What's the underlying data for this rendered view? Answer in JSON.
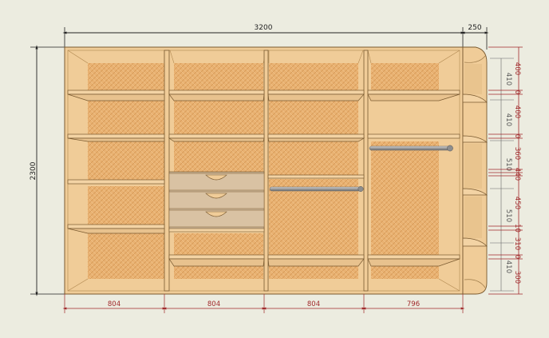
{
  "drawing": {
    "overall_width_label": "3200",
    "side_depth_label": "250",
    "overall_height_label": "2300",
    "section_widths": [
      "804",
      "804",
      "804",
      "796"
    ],
    "right_red_dims": [
      "400",
      "0",
      "400",
      "0",
      "360",
      "440",
      "450",
      "10",
      "310",
      "0",
      "300"
    ],
    "right_gray_dims": [
      "410",
      "410",
      "510",
      "510",
      "410"
    ]
  },
  "colors": {
    "background": "#ecece0",
    "wood": "#f0cc98",
    "wood_edge": "#7a5a30",
    "panel": "#e7ae6c",
    "drawer": "#d9c2a3",
    "rail": "#9a9a9a",
    "dim_red": "#a0282a",
    "dim_black": "#222222"
  }
}
